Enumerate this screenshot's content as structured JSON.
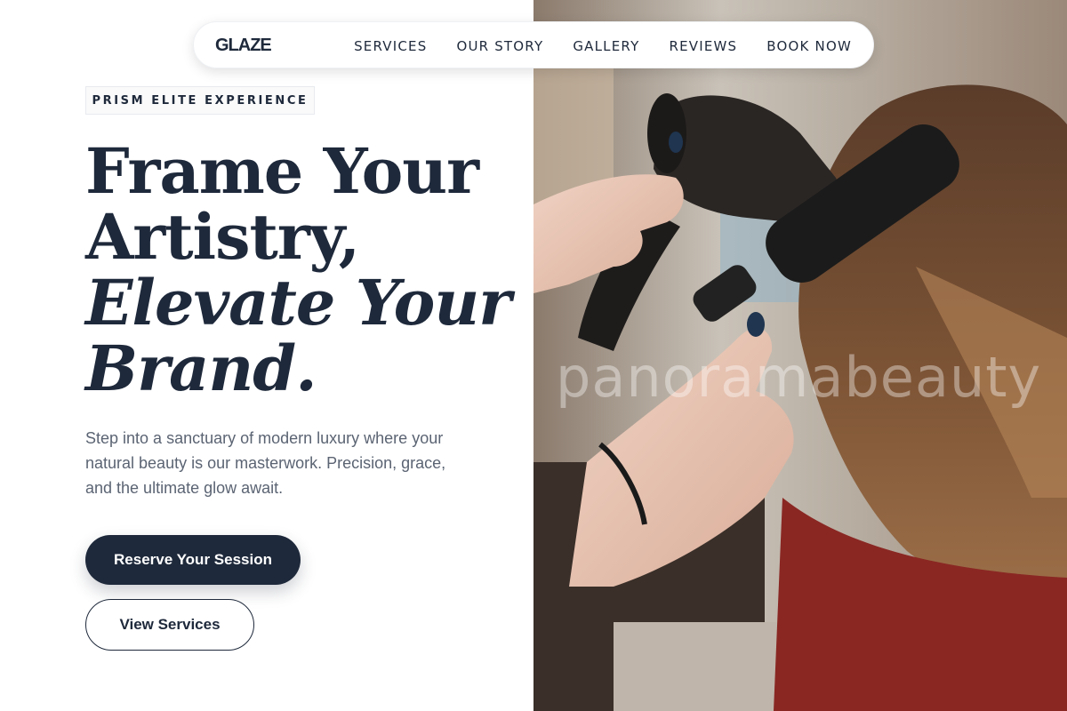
{
  "nav": {
    "logo": "GLAZE",
    "links": [
      "SERVICES",
      "OUR STORY",
      "GALLERY",
      "REVIEWS",
      "BOOK NOW"
    ]
  },
  "hero": {
    "eyebrow": "PRISM ELITE EXPERIENCE",
    "headline_lines": [
      "Frame Your",
      "Artistry,",
      "Elevate Your",
      "Brand."
    ],
    "description": "Step into a sanctuary of modern luxury where your natural beauty is our masterwork. Precision, grace, and the ultimate glow await.",
    "primary_cta": "Reserve Your Session",
    "secondary_cta": "View Services"
  },
  "photo": {
    "watermark": "panoramabeauty"
  },
  "colors": {
    "primary": "#1e293b",
    "body_text": "#5b6473",
    "background": "#ffffff"
  }
}
